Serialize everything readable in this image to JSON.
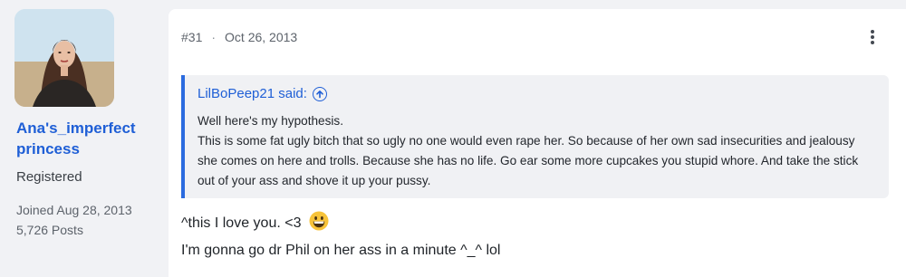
{
  "user": {
    "name": "Ana's_imperfect princess",
    "title": "Registered",
    "joined": "Joined Aug 28, 2013",
    "posts": "5,726 Posts"
  },
  "post": {
    "number": "#31",
    "separator": "·",
    "date": "Oct 26, 2013",
    "more_icon": "vertical-ellipsis-icon",
    "quote": {
      "author": "LilBoPeep21 said:",
      "jump_icon": "arrow-up-circle-icon",
      "line1": "Well here's my hypothesis.",
      "line2": "This is some fat ugly bitch that so ugly no one would even rape her. So because of her own sad insecurities and jealousy she comes on here and trolls. Because she has no life. Go ear some more cupcakes you stupid whore. And take the stick out of your ass and shove it up your pussy."
    },
    "body_line1": "^this I love you. <3",
    "emoji_icon": "grinning-face-icon",
    "body_line2": "I'm gonna go dr Phil on her ass in a minute ^_^ lol"
  },
  "colors": {
    "link": "#1f5fd6",
    "quote_accent": "#2b6bdf",
    "page_bg": "#f1f2f5",
    "quote_bg": "#f0f1f4"
  }
}
